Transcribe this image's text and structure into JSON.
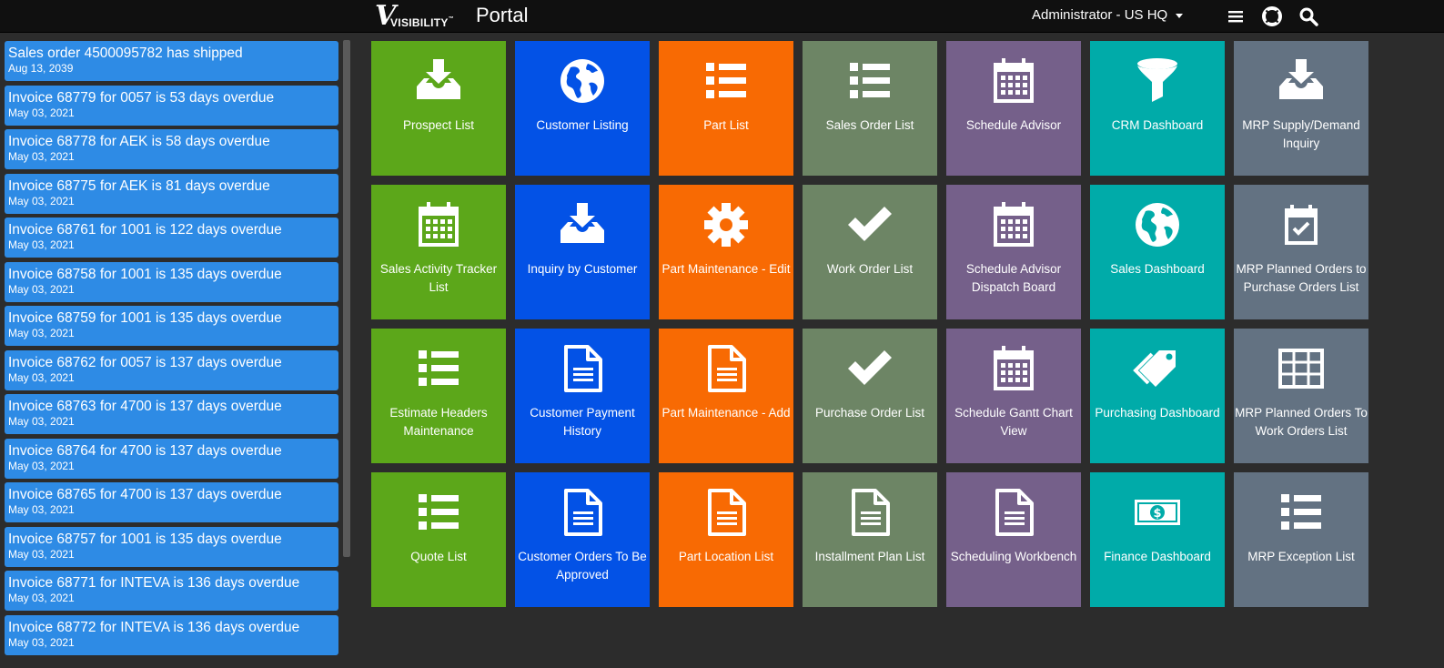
{
  "header": {
    "logo_text": "VISIBILITY",
    "logo_mark": "V",
    "logo_tm": "™",
    "portal_title": "Portal",
    "user_label": "Administrator - US HQ",
    "icons": [
      "hamburger-menu-icon",
      "lifebuoy-help-icon",
      "search-icon"
    ]
  },
  "notifications": [
    {
      "title": "Sales order 4500095782 has shipped",
      "date": "Aug 13, 2039"
    },
    {
      "title": "Invoice 68779 for 0057 is 53 days overdue",
      "date": "May 03, 2021"
    },
    {
      "title": "Invoice 68778 for AEK is 58 days overdue",
      "date": "May 03, 2021"
    },
    {
      "title": "Invoice 68775 for AEK is 81 days overdue",
      "date": "May 03, 2021"
    },
    {
      "title": "Invoice 68761 for 1001 is 122 days overdue",
      "date": "May 03, 2021"
    },
    {
      "title": "Invoice 68758 for 1001 is 135 days overdue",
      "date": "May 03, 2021"
    },
    {
      "title": "Invoice 68759 for 1001 is 135 days overdue",
      "date": "May 03, 2021"
    },
    {
      "title": "Invoice 68762 for 0057 is 137 days overdue",
      "date": "May 03, 2021"
    },
    {
      "title": "Invoice 68763 for 4700 is 137 days overdue",
      "date": "May 03, 2021"
    },
    {
      "title": "Invoice 68764 for 4700 is 137 days overdue",
      "date": "May 03, 2021"
    },
    {
      "title": "Invoice 68765 for 4700 is 137 days overdue",
      "date": "May 03, 2021"
    },
    {
      "title": "Invoice 68757 for 1001 is 135 days overdue",
      "date": "May 03, 2021"
    },
    {
      "title": "Invoice 68771 for INTEVA is 136 days overdue",
      "date": "May 03, 2021"
    },
    {
      "title": "Invoice 68772 for INTEVA is 136 days overdue",
      "date": "May 03, 2021"
    }
  ],
  "tiles": [
    {
      "label": "Prospect List",
      "icon": "inbox-download-icon",
      "color": "#5ca71a"
    },
    {
      "label": "Customer Listing",
      "icon": "globe-icon",
      "color": "#0352e6"
    },
    {
      "label": "Part List",
      "icon": "list-icon",
      "color": "#f86a03"
    },
    {
      "label": "Sales Order List",
      "icon": "list-icon",
      "color": "#6d8565"
    },
    {
      "label": "Schedule Advisor",
      "icon": "calendar-icon",
      "color": "#75608a"
    },
    {
      "label": "CRM Dashboard",
      "icon": "funnel-icon",
      "color": "#00aba9"
    },
    {
      "label": "MRP Supply/Demand Inquiry",
      "icon": "inbox-download-icon",
      "color": "#637282"
    },
    {
      "label": "Sales Activity Tracker List",
      "icon": "calendar-icon",
      "color": "#5ca71a"
    },
    {
      "label": "Inquiry by Customer",
      "icon": "inbox-download-icon",
      "color": "#0352e6"
    },
    {
      "label": "Part Maintenance - Edit",
      "icon": "gear-icon",
      "color": "#f86a03"
    },
    {
      "label": "Work Order List",
      "icon": "checkmark-icon",
      "color": "#6d8565"
    },
    {
      "label": "Schedule Advisor Dispatch Board",
      "icon": "calendar-icon",
      "color": "#75608a"
    },
    {
      "label": "Sales Dashboard",
      "icon": "globe-icon",
      "color": "#00aba9"
    },
    {
      "label": "MRP Planned Orders to Purchase Orders List",
      "icon": "calendar-check-icon",
      "color": "#637282"
    },
    {
      "label": "Estimate Headers Maintenance",
      "icon": "list-icon",
      "color": "#5ca71a"
    },
    {
      "label": "Customer Payment History",
      "icon": "document-icon",
      "color": "#0352e6"
    },
    {
      "label": "Part Maintenance - Add",
      "icon": "document-icon",
      "color": "#f86a03"
    },
    {
      "label": "Purchase Order List",
      "icon": "checkmark-icon",
      "color": "#6d8565"
    },
    {
      "label": "Schedule Gantt Chart View",
      "icon": "calendar-icon",
      "color": "#75608a"
    },
    {
      "label": "Purchasing Dashboard",
      "icon": "tags-icon",
      "color": "#00aba9"
    },
    {
      "label": "MRP Planned Orders To Work Orders List",
      "icon": "table-grid-icon",
      "color": "#637282"
    },
    {
      "label": "Quote List",
      "icon": "list-icon",
      "color": "#5ca71a"
    },
    {
      "label": "Customer Orders To Be Approved",
      "icon": "document-icon",
      "color": "#0352e6"
    },
    {
      "label": "Part Location List",
      "icon": "document-icon",
      "color": "#f86a03"
    },
    {
      "label": "Installment Plan List",
      "icon": "document-icon",
      "color": "#6d8565"
    },
    {
      "label": "Scheduling Workbench",
      "icon": "document-icon",
      "color": "#75608a"
    },
    {
      "label": "Finance Dashboard",
      "icon": "money-bill-icon",
      "color": "#00aba9"
    },
    {
      "label": "MRP Exception List",
      "icon": "list-icon",
      "color": "#637282"
    }
  ]
}
